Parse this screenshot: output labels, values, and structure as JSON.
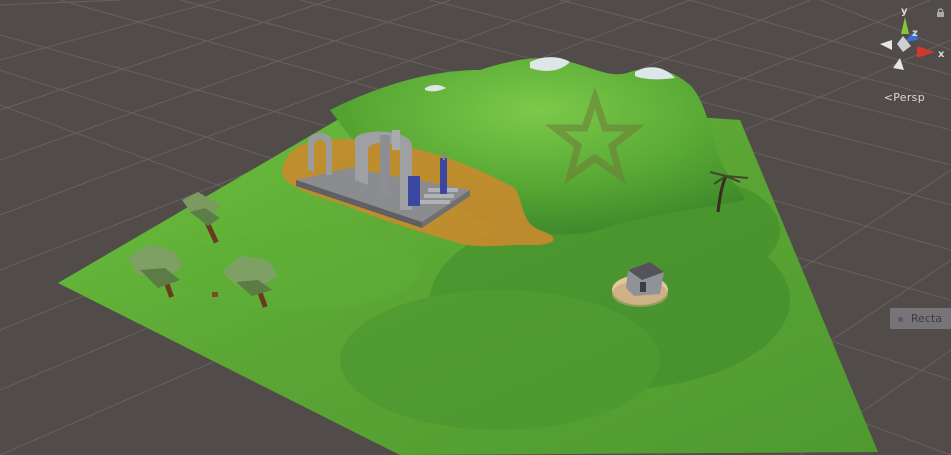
{
  "scene": {
    "colors": {
      "background": "#514c4a",
      "grid": "#6a6664",
      "terrain_base": "#63b83a",
      "terrain_dark": "#3f8a2b",
      "sand": "#c98a2e",
      "snow": "#d8e0e6"
    }
  },
  "gizmo": {
    "axis_y": "y",
    "axis_z": "z",
    "axis_x": "x",
    "projection_label": "Persp",
    "colors": {
      "x": "#d03a2c",
      "y": "#86c43a",
      "z": "#3a6fd8"
    },
    "icons": [
      "lock-icon",
      "orientation-gizmo-icon"
    ]
  },
  "overlay": {
    "label": "Recta"
  }
}
